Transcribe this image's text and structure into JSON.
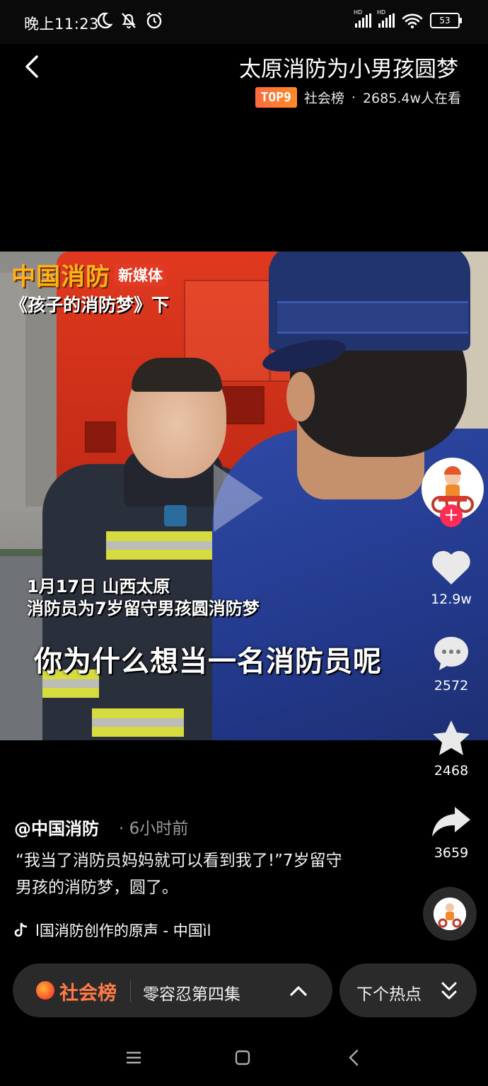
{
  "status_bar": {
    "time": "晚上11:23",
    "network_label_1": "HD",
    "network_label_2": "HD",
    "battery": "53"
  },
  "header": {
    "title": "太原消防为小男孩圆梦",
    "rank_badge": "TOP9",
    "rank_category": "社会榜",
    "dot": "·",
    "viewers": "2685.4w人在看"
  },
  "video": {
    "brand_name": "中国消防",
    "brand_tag": "新媒体",
    "episode": "《孩子的消防梦》下",
    "caption_line1": "1月17日 山西太原",
    "caption_line2": "消防员为7岁留守男孩圆消防梦",
    "subtitle": "你为什么想当一名消防员呢"
  },
  "rail": {
    "likes": "12.9w",
    "comments": "2572",
    "favorites": "2468",
    "shares": "3659"
  },
  "post": {
    "author": "@中国消防",
    "time": "· 6小时前",
    "description": "“我当了消防员妈妈就可以看到我了!”7岁留守男孩的消防梦，圆了。",
    "music": "l国消防创作的原声 - 中国ìl"
  },
  "bottom_bar": {
    "hot_label": "社会榜",
    "topic": "零容忍第四集",
    "next_label": "下个热点"
  },
  "colors": {
    "accent": "#ff2c55",
    "hot": "#ff7a45",
    "badge": "#ff6a3d"
  }
}
